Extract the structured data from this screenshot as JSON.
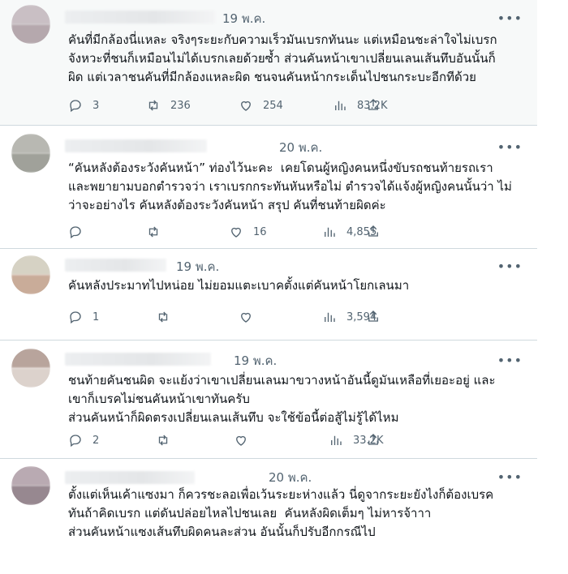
{
  "tweets": [
    {
      "date": "19 พ.ค.",
      "lines": [
        "คันที่มีกล้องนี่แหละ จริงๆระยะกับความเร็วมันเบรกทันนะ แต่เหมือนชะล่าใจไม่เบรก",
        "จังหวะที่ชนก็เหมือนไม่ได้เบรกเลยด้วยซ้ำ ส่วนคันหน้าเขาเปลี่ยนเลนเส้นทึบอันนั้นก็",
        "ผิด แต่เวลาชนคันที่มีกล้องแหละผิด ชนจนคันหน้ากระเด็นไปชนกระบะอีกทีด้วย"
      ],
      "replies": "3",
      "retweets": "236",
      "likes": "254",
      "views": "83.2K"
    },
    {
      "date": "20 พ.ค.",
      "lines": [
        "“คันหลังต้องระวังคันหน้า” ท่องไว้นะคะ  เคยโดนผู้หญิงคนหนึ่งขับรถชนท้ายรถเรา",
        "และพยายามบอกตำรวจว่า เราเบรกกระทันหันหรือไม่ ตำรวจได้แจ้งผู้หญิงคนนั้นว่า ไม่",
        "ว่าจะอย่างไร คันหลังต้องระวังคันหน้า สรุป คันที่ชนท้ายผิดค่ะ"
      ],
      "replies": "",
      "retweets": "",
      "likes": "16",
      "views": "4,855"
    },
    {
      "date": "19 พ.ค.",
      "lines": [
        "คันหลังประมาทไปหน่อย ไม่ยอมแตะเบาคตั้งแต่คันหน้าโยกเลนมา"
      ],
      "replies": "1",
      "retweets": "",
      "likes": "",
      "views": "3,594"
    },
    {
      "date": "19 พ.ค.",
      "lines": [
        "ชนท้ายคันชนผิด จะแย้งว่าเขาเปลี่ยนเลนมาขวางหน้าอันนี้ดูมันเหลือที่เยอะอยู่ และ",
        "เขาก็เบรคไม่ชนคันหน้าเขาทันครับ",
        "ส่วนคันหน้าก็ผิดตรงเปลี่ยนเลนเส้นทึบ จะใช้ข้อนี้ต่อสู้ไม่รู้ได้ไหม"
      ],
      "replies": "2",
      "retweets": "",
      "likes": "",
      "views": "33.2K"
    },
    {
      "date": "20 พ.ค.",
      "lines": [
        "ตั้งแต่เห็นเค้าแซงมา ก็ควรชะลอเพื่อเว้นระยะห่างแล้ว นี่ดูจากระยะยังไงก็ต้องเบรค",
        "ทันถ้าคิดเบรก แต่ดันปล่อยไหลไปชนเลย  คันหลังผิดเต็มๆ ไม่หารจ้าาา",
        "",
        "ส่วนคันหน้าแซงเส้นทึบผิดคนละส่วน อันนั้นก็ปรับอีกกรณีไป"
      ],
      "replies": "",
      "retweets": "",
      "likes": "",
      "views": ""
    }
  ],
  "icons": {
    "reply": "reply-icon",
    "retweet": "retweet-icon",
    "like": "heart-icon",
    "views": "views-icon",
    "share": "share-icon",
    "more": "more-icon"
  },
  "more_label": "•••"
}
